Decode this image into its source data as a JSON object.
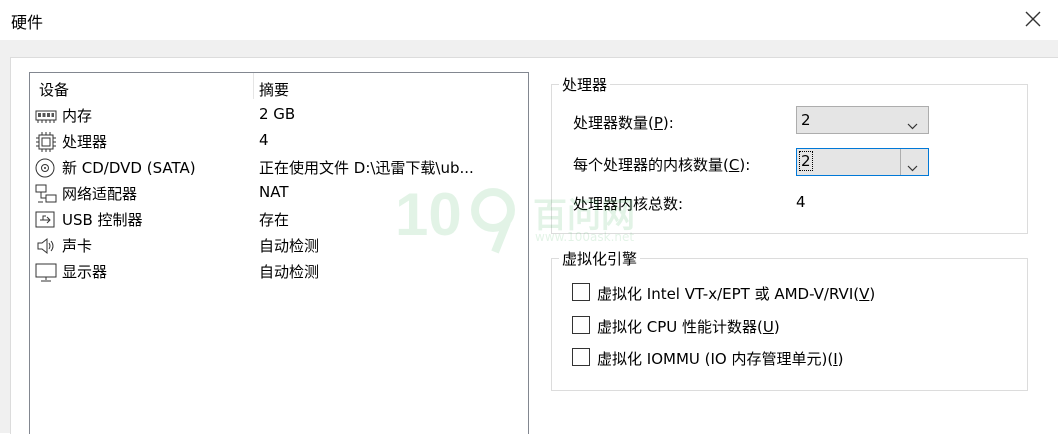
{
  "window": {
    "title": "硬件",
    "close_icon": "close-icon"
  },
  "devices": {
    "header_device": "设备",
    "header_summary": "摘要",
    "items": [
      {
        "icon": "memory-icon",
        "name": "内存",
        "summary": "2 GB"
      },
      {
        "icon": "processor-icon",
        "name": "处理器",
        "summary": "4"
      },
      {
        "icon": "cd-dvd-icon",
        "name": "新 CD/DVD (SATA)",
        "summary": "正在使用文件 D:\\迅雷下载\\ub..."
      },
      {
        "icon": "network-adapter-icon",
        "name": "网络适配器",
        "summary": "NAT"
      },
      {
        "icon": "usb-icon",
        "name": "USB 控制器",
        "summary": "存在"
      },
      {
        "icon": "sound-card-icon",
        "name": "声卡",
        "summary": "自动检测"
      },
      {
        "icon": "display-icon",
        "name": "显示器",
        "summary": "自动检测"
      }
    ]
  },
  "processor": {
    "group_label": "处理器",
    "count_label": "处理器数量(P):",
    "count_label_pre": "处理器数量(",
    "count_label_key": "P",
    "count_label_post": "):",
    "count_value": "2",
    "cores_label": "每个处理器的内核数量(C):",
    "cores_label_pre": "每个处理器的内核数量(",
    "cores_label_key": "C",
    "cores_label_post": "):",
    "cores_value": "2",
    "total_label": "处理器内核总数:",
    "total_value": "4"
  },
  "virtualization": {
    "group_label": "虚拟化引擎",
    "options": [
      {
        "pre": "虚拟化 Intel VT-x/EPT 或 AMD-V/RVI(",
        "key": "V",
        "post": ")",
        "checked": false
      },
      {
        "pre": "虚拟化 CPU 性能计数器(",
        "key": "U",
        "post": ")",
        "checked": false
      },
      {
        "pre": "虚拟化 IOMMU (IO 内存管理单元)(",
        "key": "I",
        "post": ")",
        "checked": false
      }
    ]
  },
  "watermark": {
    "text": "百问网",
    "url": "www.100ask.net"
  }
}
